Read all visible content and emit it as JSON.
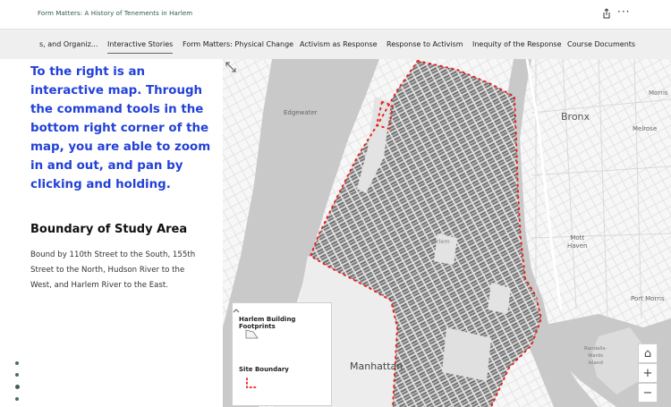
{
  "header": {
    "title": "Form Matters: A History of Tenements in Harlem",
    "more_label": "···"
  },
  "nav": {
    "items": [
      {
        "label": "s, and Organiz..."
      },
      {
        "label": "Interactive Stories"
      },
      {
        "label": "Form Matters: Physical Change"
      },
      {
        "label": "Activism as Response"
      },
      {
        "label": "Response to Activism"
      },
      {
        "label": "Inequity of the Response"
      },
      {
        "label": "Course Documents"
      }
    ],
    "active_index": 1
  },
  "content": {
    "lead": "To the right is an interactive map. Through the command tools in the bottom right corner of the map, you are able to zoom in and out, and pan by clicking and holding.",
    "lead_color": "#2341d8",
    "heading": "Boundary of Study Area",
    "body": "Bound by 110th Street to the South, 155th Street to the North, Hudson River to the West, and Harlem River to the East."
  },
  "map": {
    "labels": {
      "edgewater": "Edgewater",
      "bronx": "Bronx",
      "melrose": "Melrose",
      "morris": "Morris",
      "mott_haven": "Mott\nHaven",
      "port_morris": "Port Morris",
      "manhattan": "Manhattan",
      "harlem": "Harlem",
      "randalls": "Randalls-\nWards\nIsland"
    },
    "boundary_color": "#e8231f",
    "legend": {
      "layer1": "Harlem Building Footprints",
      "layer2": "Site Boundary"
    },
    "controls": {
      "home_label": "⌂",
      "zoom_in_label": "+",
      "zoom_out_label": "−"
    }
  }
}
